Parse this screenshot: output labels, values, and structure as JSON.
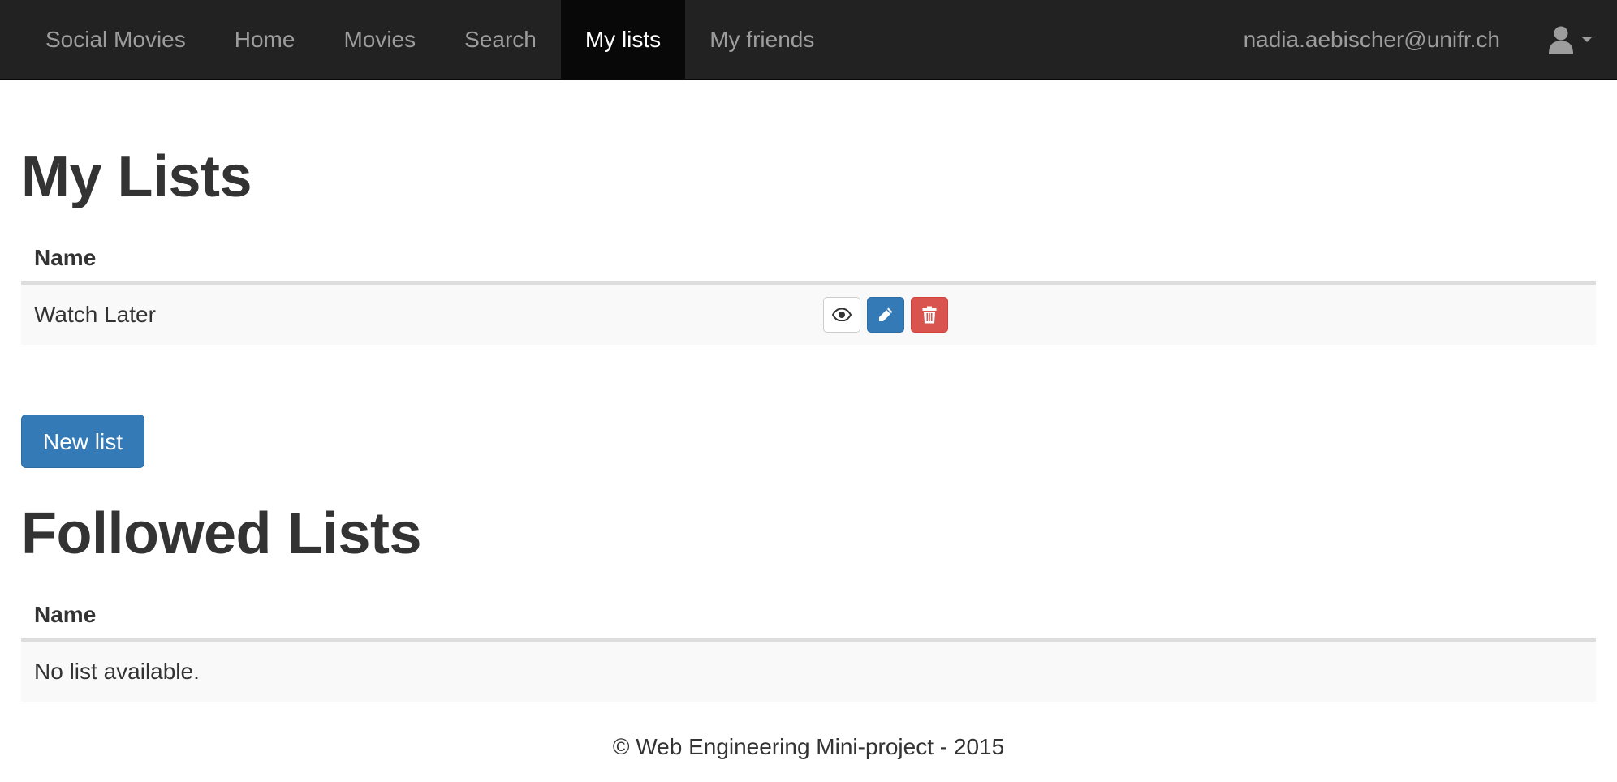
{
  "navbar": {
    "brand": "Social Movies",
    "items": [
      {
        "label": "Home"
      },
      {
        "label": "Movies"
      },
      {
        "label": "Search"
      },
      {
        "label": "My lists",
        "active": true
      },
      {
        "label": "My friends"
      }
    ],
    "user_email": "nadia.aebischer@unifr.ch",
    "user_icon": "user-icon",
    "dropdown_icon": "caret-down-icon"
  },
  "my_lists": {
    "title": "My Lists",
    "column_header": "Name",
    "rows": [
      {
        "name": "Watch Later",
        "actions": [
          "eye-icon",
          "pencil-icon",
          "trash-icon"
        ]
      }
    ],
    "new_list_label": "New list"
  },
  "followed_lists": {
    "title": "Followed Lists",
    "column_header": "Name",
    "empty_text": "No list available."
  },
  "footer": {
    "text": "© Web Engineering Mini-project - 2015"
  },
  "colors": {
    "navbar_bg": "#222222",
    "navbar_active_bg": "#080808",
    "primary": "#337ab7",
    "danger": "#d9534f"
  }
}
